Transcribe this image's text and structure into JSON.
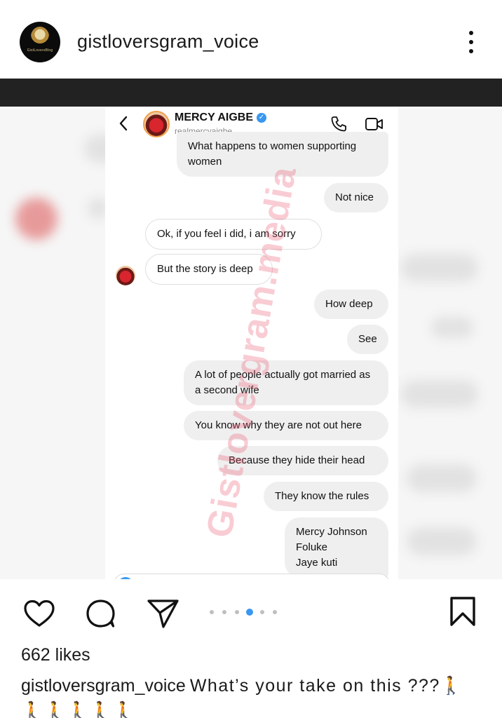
{
  "post": {
    "username": "gistloversgram_voice",
    "avatar_text": "GistLoversBlog",
    "likes_text": "662 likes",
    "caption_user": "gistloversgram_voice",
    "caption_text": "What’s your take on this ???🚶🚶🚶🚶🚶🚶",
    "carousel": {
      "total": 6,
      "active_index": 3
    },
    "accent_color": "#3897f0"
  },
  "chat": {
    "contact_name": "MERCY AIGBE",
    "contact_handle": "realmercyaigbe",
    "watermark": "Gistlovergram.media",
    "messages": [
      {
        "from": "me",
        "text": "What happens to women supporting women"
      },
      {
        "from": "me",
        "text": "Not nice"
      },
      {
        "from": "them",
        "text": "Ok, if you feel i did, i am sorry"
      },
      {
        "from": "them",
        "text": "But the story is deep"
      },
      {
        "from": "me",
        "text": "How deep"
      },
      {
        "from": "me",
        "text": "See"
      },
      {
        "from": "me",
        "text": "A lot of people actually got married as a second wife"
      },
      {
        "from": "me",
        "text": "You know why they are not out here"
      },
      {
        "from": "me",
        "text": "Because they hide their head"
      },
      {
        "from": "me",
        "text": "They know the rules"
      },
      {
        "from": "me",
        "lines": [
          "Mercy Johnson",
          "Foluke",
          "Jaye kuti"
        ]
      }
    ]
  },
  "icons": {
    "more": "more-vertical-icon",
    "back": "chevron-left-icon",
    "verified": "verified-badge-icon",
    "call": "phone-icon",
    "video": "video-camera-icon",
    "like": "heart-icon",
    "comment": "comment-icon",
    "share": "send-icon",
    "save": "bookmark-icon"
  }
}
